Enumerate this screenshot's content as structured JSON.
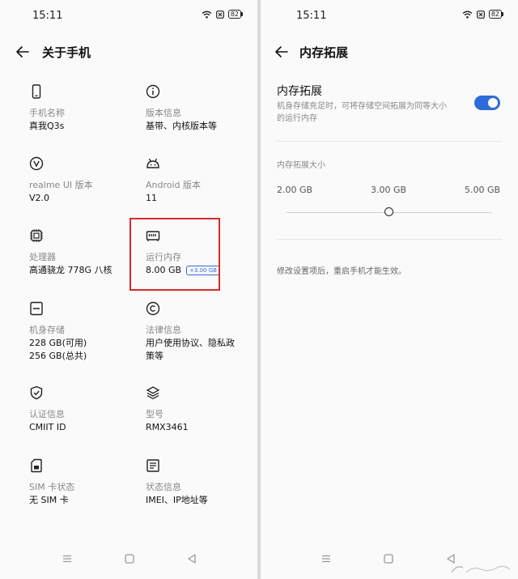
{
  "status": {
    "time": "15:11",
    "battery": "82"
  },
  "left": {
    "title": "关于手机",
    "items": [
      {
        "label": "手机名称",
        "value": "真我Q3s"
      },
      {
        "label": "版本信息",
        "value": "基带、内核版本等"
      },
      {
        "label": "realme UI 版本",
        "value": "V2.0"
      },
      {
        "label": "Android 版本",
        "value": "11"
      },
      {
        "label": "处理器",
        "value": "高通骁龙 778G 八核"
      },
      {
        "label": "运行内存",
        "value": "8.00 GB",
        "badge": "+3.00 GB"
      },
      {
        "label": "机身存储",
        "value": "228 GB(可用)",
        "value2": "256 GB(总共)"
      },
      {
        "label": "法律信息",
        "value": "用户使用协议、隐私政",
        "value2": "策等"
      },
      {
        "label": "认证信息",
        "value": "CMIIT ID"
      },
      {
        "label": "型号",
        "value": "RMX3461"
      },
      {
        "label": "SIM 卡状态",
        "value": "无 SIM 卡"
      },
      {
        "label": "状态信息",
        "value": "IMEI、IP地址等"
      }
    ]
  },
  "right": {
    "title": "内存拓展",
    "setting": {
      "title": "内存拓展",
      "desc_line1": "机身存储充足时，可将存储空间拓展为同等大小",
      "desc_line2": "的运行内存",
      "enabled": true
    },
    "size_label": "内存拓展大小",
    "options": [
      "2.00 GB",
      "3.00 GB",
      "5.00 GB"
    ],
    "selected_option": "3.00 GB",
    "note": "修改设置项后，重启手机才能生效。"
  },
  "colors": {
    "accent": "#2d6bd8",
    "highlight": "#d82a2a"
  }
}
